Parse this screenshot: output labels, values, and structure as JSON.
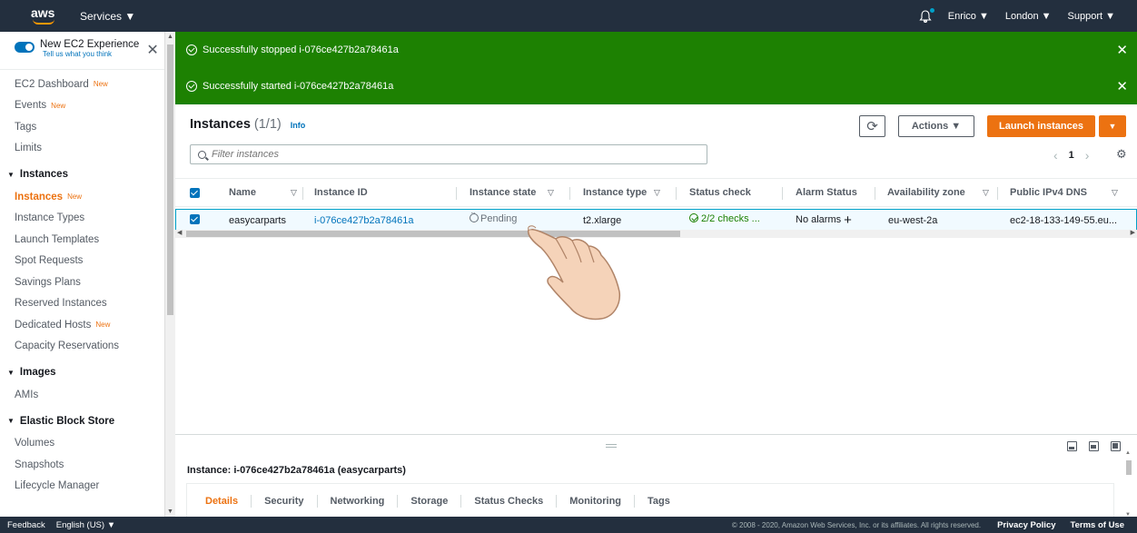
{
  "topbar": {
    "logo": "aws",
    "services": "Services ▼",
    "user": "Enrico ▼",
    "region": "London ▼",
    "support": "Support ▼"
  },
  "sidebar": {
    "experience_title": "New EC2 Experience",
    "experience_link": "Tell us what you think",
    "top_items": [
      {
        "label": "EC2 Dashboard",
        "badge": "New"
      },
      {
        "label": "Events",
        "badge": "New"
      },
      {
        "label": "Tags",
        "badge": ""
      },
      {
        "label": "Limits",
        "badge": ""
      }
    ],
    "instances_section": "Instances",
    "instances_items": [
      {
        "label": "Instances",
        "badge": "New"
      },
      {
        "label": "Instance Types",
        "badge": ""
      },
      {
        "label": "Launch Templates",
        "badge": ""
      },
      {
        "label": "Spot Requests",
        "badge": ""
      },
      {
        "label": "Savings Plans",
        "badge": ""
      },
      {
        "label": "Reserved Instances",
        "badge": ""
      },
      {
        "label": "Dedicated Hosts",
        "badge": "New"
      },
      {
        "label": "Capacity Reservations",
        "badge": ""
      }
    ],
    "images_section": "Images",
    "images_items": [
      {
        "label": "AMIs"
      }
    ],
    "ebs_section": "Elastic Block Store",
    "ebs_items": [
      {
        "label": "Volumes"
      },
      {
        "label": "Snapshots"
      },
      {
        "label": "Lifecycle Manager"
      }
    ]
  },
  "flash": {
    "stopped": "Successfully stopped i-076ce427b2a78461a",
    "started": "Successfully started i-076ce427b2a78461a"
  },
  "instances": {
    "title": "Instances",
    "count": "(1/1)",
    "info": "Info",
    "actions": "Actions ▼",
    "launch": "Launch instances",
    "launch_drop": "▼",
    "filter_placeholder": "Filter instances",
    "page": "1",
    "columns": [
      "Name",
      "Instance ID",
      "Instance state",
      "Instance type",
      "Status check",
      "Alarm Status",
      "Availability zone",
      "Public IPv4 DNS"
    ],
    "row": {
      "name": "easycarparts",
      "id": "i-076ce427b2a78461a",
      "state": "Pending",
      "type": "t2.xlarge",
      "status_check": "2/2 checks ...",
      "alarm": "No alarms",
      "az": "eu-west-2a",
      "dns": "ec2-18-133-149-55.eu..."
    }
  },
  "details": {
    "title": "Instance: i-076ce427b2a78461a (easycarparts)",
    "tabs": [
      "Details",
      "Security",
      "Networking",
      "Storage",
      "Status Checks",
      "Monitoring",
      "Tags"
    ]
  },
  "footer": {
    "feedback": "Feedback",
    "language": "English (US) ▼",
    "copyright": "© 2008 - 2020, Amazon Web Services, Inc. or its affiliates. All rights reserved.",
    "privacy": "Privacy Policy",
    "terms": "Terms of Use"
  },
  "colors": {
    "nav_bg": "#232f3e",
    "success": "#1d8102",
    "accent": "#ec7211",
    "link": "#0073bb"
  }
}
